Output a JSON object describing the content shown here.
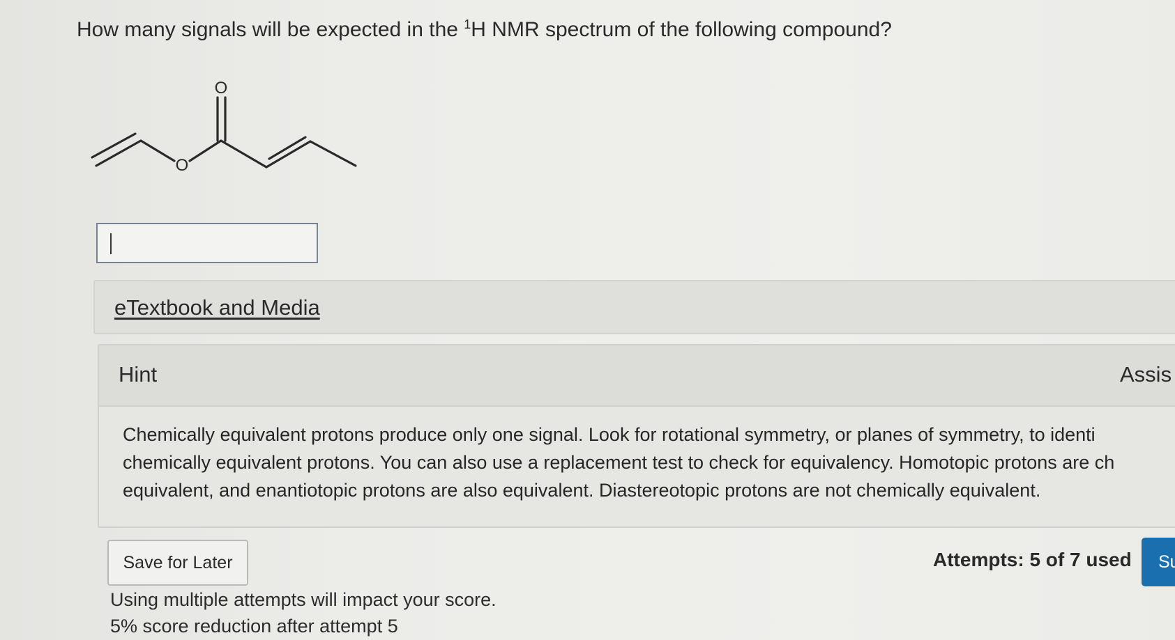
{
  "question": {
    "prefix": "How many signals will be expected in the ",
    "superscript": "1",
    "suffix": "H NMR spectrum of the following compound?"
  },
  "molecule": {
    "atom_labels": [
      "O",
      "O"
    ]
  },
  "answer": {
    "value": ""
  },
  "etextbook": {
    "link_label": "eTextbook and Media"
  },
  "hint": {
    "title": "Hint",
    "assistance_label": "Assis",
    "lines": [
      "Chemically equivalent protons produce only one signal. Look for rotational symmetry, or planes of symmetry, to identi",
      "chemically equivalent protons. You can also use a replacement test to check for equivalency. Homotopic protons are ch",
      "equivalent, and enantiotopic protons are also equivalent. Diastereotopic protons are not chemically equivalent."
    ]
  },
  "footer": {
    "save_label": "Save for Later",
    "attempts": "Attempts: 5 of 7 used",
    "submit_label": "Su",
    "note_line1": "Using multiple attempts will impact your score.",
    "note_line2": "5% score reduction after attempt 5"
  },
  "colors": {
    "submit_bg": "#1a6fae",
    "input_border": "#7a8290"
  }
}
